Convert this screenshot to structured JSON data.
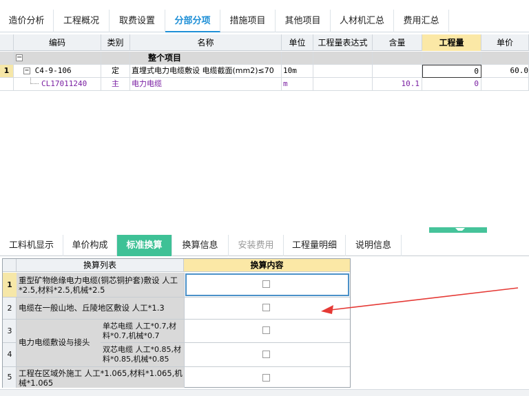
{
  "top_tabs": [
    "造价分析",
    "工程概况",
    "取费设置",
    "分部分项",
    "措施项目",
    "其他项目",
    "人材机汇总",
    "费用汇总"
  ],
  "top_tabs_active": 3,
  "grid": {
    "headers": [
      "编码",
      "类别",
      "名称",
      "单位",
      "工程量表达式",
      "含量",
      "工程量",
      "单价"
    ],
    "section": "整个项目",
    "rows": [
      {
        "num": "1",
        "code": "C4-9-106",
        "type": "定",
        "name": "直埋式电力电缆敷设 电缆截面(mm2)≤70",
        "unit": "10m",
        "expr": "",
        "content": "",
        "qty": "0",
        "price": "60.0"
      },
      {
        "num": "",
        "code": "CL17011240",
        "type": "主",
        "name": "电力电缆",
        "unit": "m",
        "expr": "",
        "content": "10.1",
        "qty": "0",
        "price": ""
      }
    ]
  },
  "bottom_tabs": [
    "工料机显示",
    "单价构成",
    "标准换算",
    "换算信息",
    "安装费用",
    "工程量明细",
    "说明信息"
  ],
  "bottom_tabs_active": 2,
  "bottom_tabs_disabled": [
    4
  ],
  "conversion": {
    "headers": [
      "换算列表",
      "换算内容"
    ],
    "rows": [
      {
        "num": "1",
        "text": "重型矿物绝缘电力电缆(铜芯铜护套)敷设 人工*2.5,材料*2.5,机械*2.5"
      },
      {
        "num": "2",
        "text": "电缆在一般山地、丘陵地区敷设 人工*1.3"
      },
      {
        "num": "3",
        "group": "电力电缆敷设与接头",
        "text": "单芯电缆 人工*0.7,材料*0.7,机械*0.7"
      },
      {
        "num": "4",
        "text": "双芯电缆 人工*0.85,材料*0.85,机械*0.85"
      },
      {
        "num": "5",
        "text": "工程在区域外施工 人工*1.065,材料*1.065,机械*1.065"
      }
    ]
  },
  "colors": {
    "accent": "#1e8fd6",
    "green": "#3ec196",
    "arrow": "#e53935"
  }
}
